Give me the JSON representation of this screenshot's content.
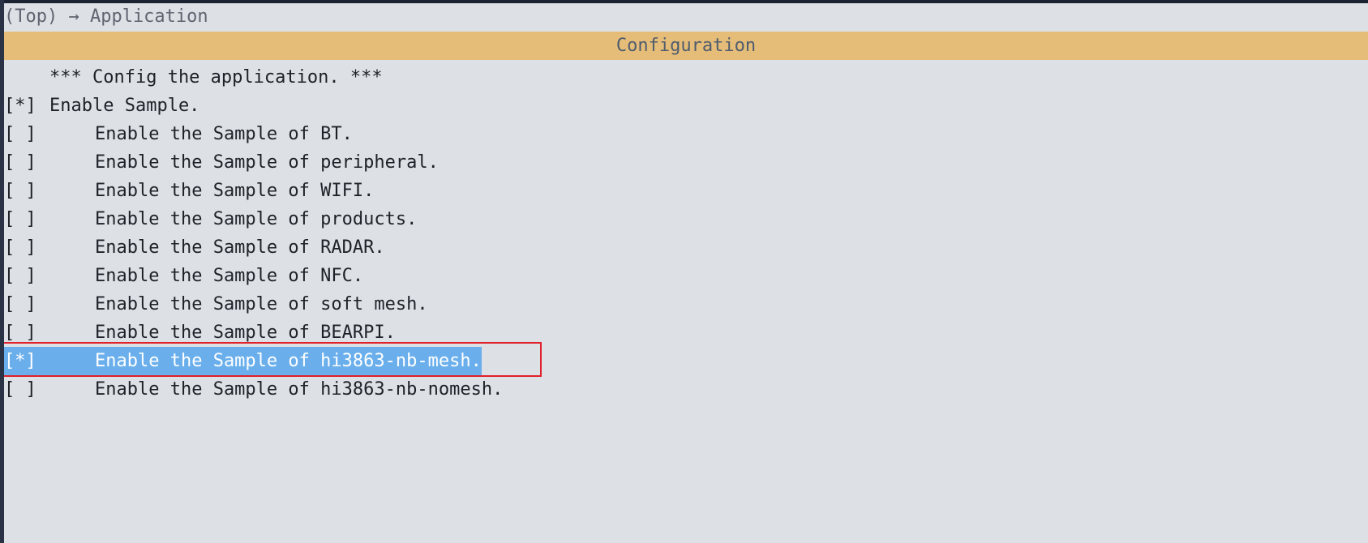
{
  "breadcrumb": "(Top) → Application",
  "title": "Configuration",
  "menu": {
    "comment": "*** Config the application. ***",
    "items": [
      {
        "check": "[*]",
        "label": "Enable Sample."
      },
      {
        "check": "[ ]",
        "label": "Enable the Sample of BT."
      },
      {
        "check": "[ ]",
        "label": "Enable the Sample of peripheral."
      },
      {
        "check": "[ ]",
        "label": "Enable the Sample of WIFI."
      },
      {
        "check": "[ ]",
        "label": "Enable the Sample of products."
      },
      {
        "check": "[ ]",
        "label": "Enable the Sample of RADAR."
      },
      {
        "check": "[ ]",
        "label": "Enable the Sample of NFC."
      },
      {
        "check": "[ ]",
        "label": "Enable the Sample of soft mesh."
      },
      {
        "check": "[ ]",
        "label": "Enable the Sample of BEARPI."
      },
      {
        "check": "[*]",
        "label": "Enable the Sample of hi3863-nb-mesh."
      },
      {
        "check": "[ ]",
        "label": "Enable the Sample of hi3863-nb-nomesh."
      }
    ]
  },
  "colors": {
    "title_bg": "#e6bd78",
    "selection_bg": "#6aafec",
    "highlight_border": "#e0202a",
    "background": "#dde1e6"
  }
}
